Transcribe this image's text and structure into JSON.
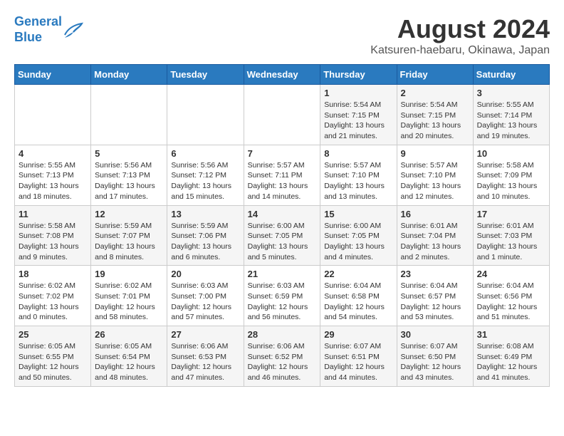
{
  "header": {
    "logo_line1": "General",
    "logo_line2": "Blue",
    "title": "August 2024",
    "subtitle": "Katsuren-haebaru, Okinawa, Japan"
  },
  "days_of_week": [
    "Sunday",
    "Monday",
    "Tuesday",
    "Wednesday",
    "Thursday",
    "Friday",
    "Saturday"
  ],
  "weeks": [
    [
      {
        "day": "",
        "info": ""
      },
      {
        "day": "",
        "info": ""
      },
      {
        "day": "",
        "info": ""
      },
      {
        "day": "",
        "info": ""
      },
      {
        "day": "1",
        "info": "Sunrise: 5:54 AM\nSunset: 7:15 PM\nDaylight: 13 hours\nand 21 minutes."
      },
      {
        "day": "2",
        "info": "Sunrise: 5:54 AM\nSunset: 7:15 PM\nDaylight: 13 hours\nand 20 minutes."
      },
      {
        "day": "3",
        "info": "Sunrise: 5:55 AM\nSunset: 7:14 PM\nDaylight: 13 hours\nand 19 minutes."
      }
    ],
    [
      {
        "day": "4",
        "info": "Sunrise: 5:55 AM\nSunset: 7:13 PM\nDaylight: 13 hours\nand 18 minutes."
      },
      {
        "day": "5",
        "info": "Sunrise: 5:56 AM\nSunset: 7:13 PM\nDaylight: 13 hours\nand 17 minutes."
      },
      {
        "day": "6",
        "info": "Sunrise: 5:56 AM\nSunset: 7:12 PM\nDaylight: 13 hours\nand 15 minutes."
      },
      {
        "day": "7",
        "info": "Sunrise: 5:57 AM\nSunset: 7:11 PM\nDaylight: 13 hours\nand 14 minutes."
      },
      {
        "day": "8",
        "info": "Sunrise: 5:57 AM\nSunset: 7:10 PM\nDaylight: 13 hours\nand 13 minutes."
      },
      {
        "day": "9",
        "info": "Sunrise: 5:57 AM\nSunset: 7:10 PM\nDaylight: 13 hours\nand 12 minutes."
      },
      {
        "day": "10",
        "info": "Sunrise: 5:58 AM\nSunset: 7:09 PM\nDaylight: 13 hours\nand 10 minutes."
      }
    ],
    [
      {
        "day": "11",
        "info": "Sunrise: 5:58 AM\nSunset: 7:08 PM\nDaylight: 13 hours\nand 9 minutes."
      },
      {
        "day": "12",
        "info": "Sunrise: 5:59 AM\nSunset: 7:07 PM\nDaylight: 13 hours\nand 8 minutes."
      },
      {
        "day": "13",
        "info": "Sunrise: 5:59 AM\nSunset: 7:06 PM\nDaylight: 13 hours\nand 6 minutes."
      },
      {
        "day": "14",
        "info": "Sunrise: 6:00 AM\nSunset: 7:05 PM\nDaylight: 13 hours\nand 5 minutes."
      },
      {
        "day": "15",
        "info": "Sunrise: 6:00 AM\nSunset: 7:05 PM\nDaylight: 13 hours\nand 4 minutes."
      },
      {
        "day": "16",
        "info": "Sunrise: 6:01 AM\nSunset: 7:04 PM\nDaylight: 13 hours\nand 2 minutes."
      },
      {
        "day": "17",
        "info": "Sunrise: 6:01 AM\nSunset: 7:03 PM\nDaylight: 13 hours\nand 1 minute."
      }
    ],
    [
      {
        "day": "18",
        "info": "Sunrise: 6:02 AM\nSunset: 7:02 PM\nDaylight: 13 hours\nand 0 minutes."
      },
      {
        "day": "19",
        "info": "Sunrise: 6:02 AM\nSunset: 7:01 PM\nDaylight: 12 hours\nand 58 minutes."
      },
      {
        "day": "20",
        "info": "Sunrise: 6:03 AM\nSunset: 7:00 PM\nDaylight: 12 hours\nand 57 minutes."
      },
      {
        "day": "21",
        "info": "Sunrise: 6:03 AM\nSunset: 6:59 PM\nDaylight: 12 hours\nand 56 minutes."
      },
      {
        "day": "22",
        "info": "Sunrise: 6:04 AM\nSunset: 6:58 PM\nDaylight: 12 hours\nand 54 minutes."
      },
      {
        "day": "23",
        "info": "Sunrise: 6:04 AM\nSunset: 6:57 PM\nDaylight: 12 hours\nand 53 minutes."
      },
      {
        "day": "24",
        "info": "Sunrise: 6:04 AM\nSunset: 6:56 PM\nDaylight: 12 hours\nand 51 minutes."
      }
    ],
    [
      {
        "day": "25",
        "info": "Sunrise: 6:05 AM\nSunset: 6:55 PM\nDaylight: 12 hours\nand 50 minutes."
      },
      {
        "day": "26",
        "info": "Sunrise: 6:05 AM\nSunset: 6:54 PM\nDaylight: 12 hours\nand 48 minutes."
      },
      {
        "day": "27",
        "info": "Sunrise: 6:06 AM\nSunset: 6:53 PM\nDaylight: 12 hours\nand 47 minutes."
      },
      {
        "day": "28",
        "info": "Sunrise: 6:06 AM\nSunset: 6:52 PM\nDaylight: 12 hours\nand 46 minutes."
      },
      {
        "day": "29",
        "info": "Sunrise: 6:07 AM\nSunset: 6:51 PM\nDaylight: 12 hours\nand 44 minutes."
      },
      {
        "day": "30",
        "info": "Sunrise: 6:07 AM\nSunset: 6:50 PM\nDaylight: 12 hours\nand 43 minutes."
      },
      {
        "day": "31",
        "info": "Sunrise: 6:08 AM\nSunset: 6:49 PM\nDaylight: 12 hours\nand 41 minutes."
      }
    ]
  ]
}
